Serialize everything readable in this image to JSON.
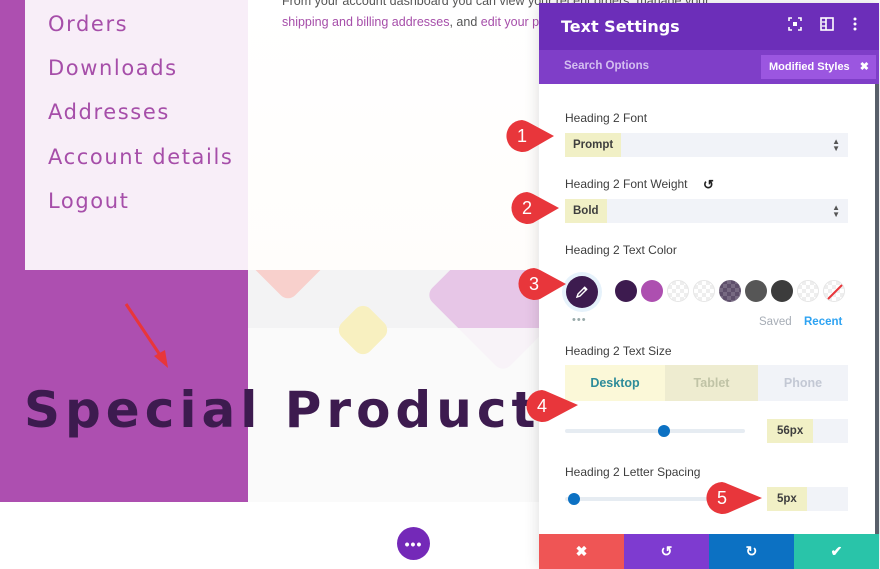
{
  "account_nav": {
    "items": [
      "Orders",
      "Downloads",
      "Addresses",
      "Account details",
      "Logout"
    ]
  },
  "intro": {
    "line1": "From your account dashboard you can view your recent orders, manage your",
    "line2_link1": "shipping and billing addresses",
    "line2_sep": ", and ",
    "line2_link2": "edit your password and account details."
  },
  "hero": {
    "heading": "Special Product Offer"
  },
  "floating_button": {
    "icon": "more-horizontal-icon",
    "label": "•••"
  },
  "panel": {
    "title": "Text Settings",
    "header_icons": [
      "focus-icon",
      "split-view-icon",
      "kebab-menu-icon"
    ],
    "search_placeholder": "Search Options",
    "modified_styles_label": "Modified Styles",
    "fields": {
      "font": {
        "label": "Heading 2 Font",
        "value": "Prompt"
      },
      "weight": {
        "label": "Heading 2 Font Weight",
        "value": "Bold"
      },
      "color": {
        "label": "Heading 2 Text Color",
        "current": "#3d1b4f",
        "swatches": [
          "#3d1b4f",
          "#ad4fb0",
          "transparent",
          "transparent",
          "#6b5c77",
          "#565656",
          "#3c3c3c",
          "transparent",
          "none"
        ],
        "saved_label": "Saved",
        "recent_label": "Recent"
      },
      "size": {
        "label": "Heading 2 Text Size",
        "devices": [
          "Desktop",
          "Tablet",
          "Phone"
        ],
        "active_device": "Desktop",
        "value": "56px",
        "slider_fraction": 0.55
      },
      "spacing": {
        "label": "Heading 2 Letter Spacing",
        "value": "5px",
        "slider_fraction": 0.05
      }
    },
    "footer": {
      "cancel": "✖",
      "undo": "↺",
      "redo": "↻",
      "save": "✔",
      "colors": {
        "cancel": "#ef5555",
        "undo": "#7e3bd0",
        "redo": "#0c71c3",
        "save": "#29c4a9"
      }
    }
  },
  "callouts": [
    "1",
    "2",
    "3",
    "4",
    "5"
  ],
  "colors": {
    "brand_purple": "#ad4fb0",
    "header_purple": "#6c2eb9",
    "heading_color": "#3d1b4f",
    "callout_red": "#e8363b"
  }
}
